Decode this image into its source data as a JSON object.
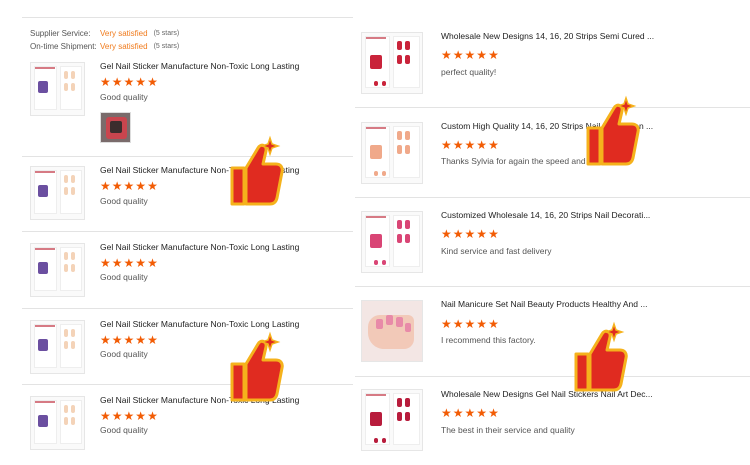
{
  "supplier": {
    "rows": [
      {
        "label": "Supplier Service:",
        "value": "Very satisfied",
        "extra": "(5 stars)"
      },
      {
        "label": "On-time Shipment:",
        "value": "Very satisfied",
        "extra": "(5 stars)"
      }
    ]
  },
  "left_reviews": [
    {
      "title": "Gel Nail Sticker Manufacture Non-Toxic Long Lasting ...",
      "rating": 5,
      "comment": "Good quality",
      "has_photo": true
    },
    {
      "title": "Gel Nail Sticker Manufacture Non-Toxic Long Lasting ...",
      "rating": 5,
      "comment": "Good quality"
    },
    {
      "title": "Gel Nail Sticker Manufacture Non-Toxic Long Lasting ...",
      "rating": 5,
      "comment": "Good quality"
    },
    {
      "title": "Gel Nail Sticker Manufacture Non-Toxic Long Lasting ...",
      "rating": 5,
      "comment": "Good quality"
    },
    {
      "title": "Gel Nail Sticker Manufacture Non-Toxic Long Lasting ...",
      "rating": 5,
      "comment": "Good quality"
    }
  ],
  "right_reviews": [
    {
      "title": "Wholesale New Designs 14, 16, 20 Strips Semi Cured ...",
      "rating": 5,
      "comment": "perfect quality!",
      "thumb_color": "#c9233a"
    },
    {
      "title": "Custom High Quality 14, 16, 20 Strips Nail Decoration ...",
      "rating": 5,
      "comment": "Thanks Sylvia for again the speed and quality.",
      "thumb_color": "#f0a98a"
    },
    {
      "title": "Customized Wholesale 14, 16, 20 Strips Nail Decorati...",
      "rating": 5,
      "comment": "Kind service and fast delivery",
      "thumb_color": "#d94575"
    },
    {
      "title": "Nail Manicure Set Nail Beauty Products Healthy And ...",
      "rating": 5,
      "comment": "I recommend this factory.",
      "thumb_color": "#e88aa8"
    },
    {
      "title": "Wholesale New Designs Gel Nail Stickers Nail Art Dec...",
      "rating": 5,
      "comment": "The best in their service and quality",
      "thumb_color": "#b81c3c"
    }
  ],
  "icons": {
    "star": "★",
    "thumbs_up": "thumbs-up-sticker-icon"
  },
  "colors": {
    "star": "#f25c05",
    "satisfied": "#f07b1d",
    "thumbs_red": "#e02b20",
    "thumbs_outline": "#f5b21c"
  }
}
